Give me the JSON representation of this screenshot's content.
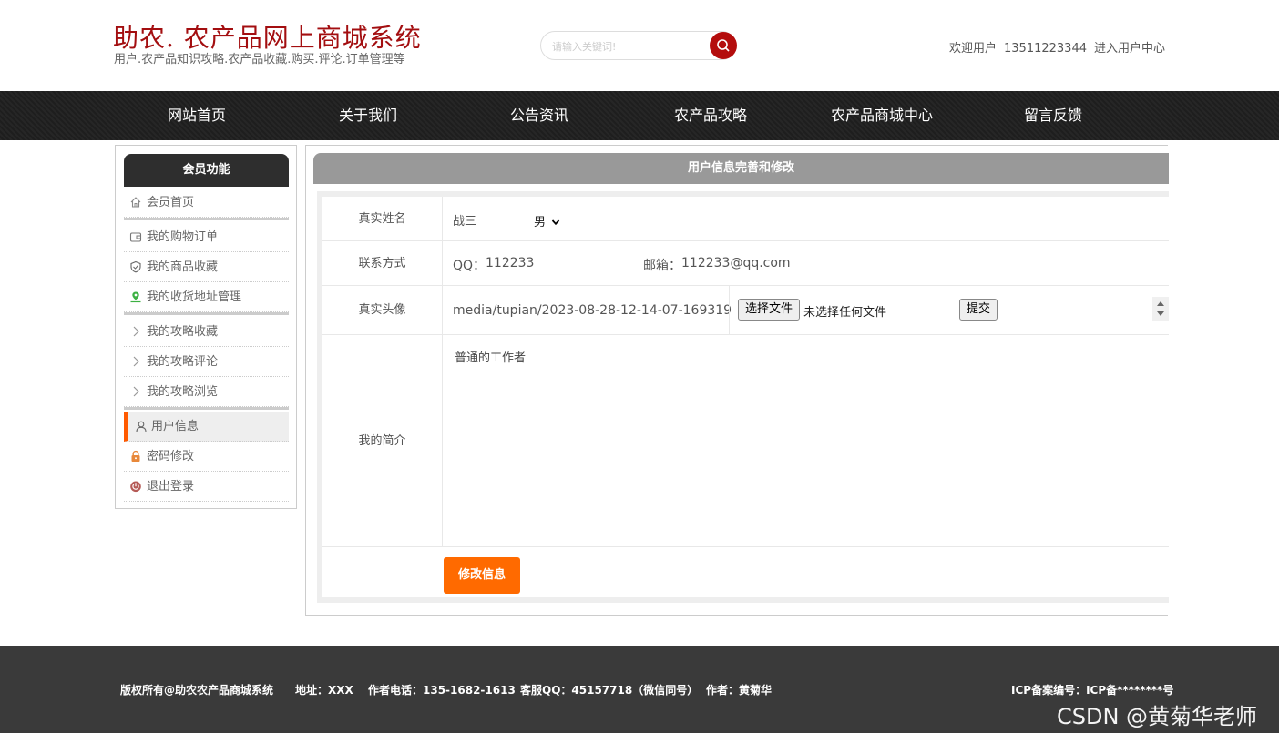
{
  "header": {
    "title": "助农. 农产品网上商城系统",
    "subtitle": "用户.农产品知识攻略.农产品收藏.购买.评论.订单管理等",
    "search_placeholder": "请输入关键词!",
    "welcome_prefix": "欢迎用户",
    "username": "13511223344",
    "user_center_link": "进入用户中心"
  },
  "nav": {
    "items": [
      {
        "label": "网站首页"
      },
      {
        "label": "关于我们"
      },
      {
        "label": "公告资讯"
      },
      {
        "label": "农产品攻略"
      },
      {
        "label": "农产品商城中心"
      },
      {
        "label": "留言反馈"
      }
    ]
  },
  "sidebar": {
    "title": "会员功能",
    "items": [
      {
        "label": "会员首页",
        "icon": "home-icon"
      },
      {
        "label": "我的购物订单",
        "icon": "wallet-icon"
      },
      {
        "label": "我的商品收藏",
        "icon": "shield-icon"
      },
      {
        "label": "我的收货地址管理",
        "icon": "location-icon"
      },
      {
        "label": "我的攻略收藏",
        "icon": "chevron-right-icon"
      },
      {
        "label": "我的攻略评论",
        "icon": "chevron-right-icon"
      },
      {
        "label": "我的攻略浏览",
        "icon": "chevron-right-icon"
      },
      {
        "label": "用户信息",
        "icon": "user-icon"
      },
      {
        "label": "密码修改",
        "icon": "lock-icon"
      },
      {
        "label": "退出登录",
        "icon": "power-icon"
      }
    ],
    "active_color": "#ff5a00"
  },
  "main": {
    "title": "用户信息完善和修改",
    "form": {
      "name_label": "真实姓名",
      "name_value": "战三",
      "gender_value": "男",
      "contact_label": "联系方式",
      "qq_label": "QQ：",
      "qq_value": "112233",
      "email_label": "邮箱：",
      "email_value": "112233@qq.com",
      "avatar_label": "真实头像",
      "avatar_path": "media/tupian/2023-08-28-12-14-07-169319",
      "file_button": "选择文件",
      "file_status": "未选择任何文件",
      "submit_button": "提交",
      "intro_label": "我的简介",
      "intro_value": "普通的工作者",
      "modify_button": "修改信息"
    },
    "accent_color": "#ff6a00"
  },
  "footer": {
    "copyright": "版权所有@助农农产品商城系统",
    "address": "地址：XXX",
    "phone": "作者电话：135-1682-1613",
    "service_qq": "客服QQ：45157718（微信同号）",
    "author": "作者：黄菊华",
    "icp": "ICP备案编号：ICP备********号",
    "watermark": "CSDN @黄菊华老师"
  },
  "colors": {
    "brand_red": "#a30e10",
    "nav_bg": "#222222",
    "footer_bg": "#3a3a3a"
  }
}
